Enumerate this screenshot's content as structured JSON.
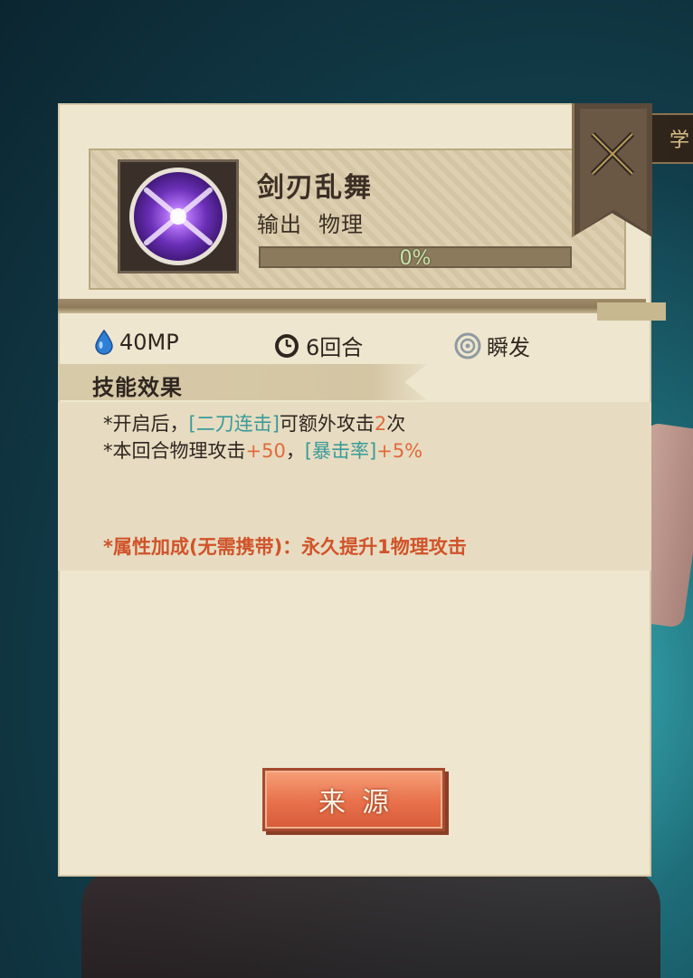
{
  "top_strip": {
    "text": "学"
  },
  "skill": {
    "name": "剑刃乱舞",
    "tag1": "输出",
    "tag2": "物理",
    "progress_percent": 0,
    "progress_label": "0%"
  },
  "stats": {
    "mp_cost": "40MP",
    "turns": "6回合",
    "cast_type": "瞬发"
  },
  "effects": {
    "section_title": "技能效果",
    "line1_prefix": "*开启后，",
    "line1_highlight": "[二刀连击]",
    "line1_middle": "可额外攻击",
    "line1_number": "2",
    "line1_suffix": "次",
    "line2_prefix": "*本回合物理攻击",
    "line2_number": "+50",
    "line2_comma": "，",
    "line2_highlight": "[暴击率]",
    "line2_number2": "+5%",
    "bonus": "*属性加成(无需携带)：永久提升1物理攻击"
  },
  "buttons": {
    "source_label": "来源"
  },
  "colors": {
    "panel_bg": "#efe6cf",
    "highlight_teal": "#3a9a9a",
    "number_orange": "#e06a3c",
    "bonus_red": "#d0532a",
    "button_orange": "#e8704a"
  },
  "icons": {
    "skill": "purple-cross-orb-icon",
    "close": "crossed-swords-close-icon",
    "mp": "water-drop-icon",
    "turns": "clock-icon",
    "cast": "target-ring-icon"
  }
}
